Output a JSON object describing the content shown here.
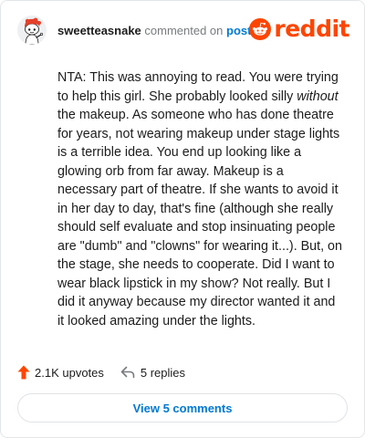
{
  "header": {
    "username": "sweetteasnake",
    "action_text": " commented on ",
    "post_link": "post",
    "brand_wordmark": "reddit",
    "brand_color": "#ff4500",
    "avatar_icon": "snoo-avatar-icon"
  },
  "comment": {
    "part1": "NTA: This was annoying to read. You were trying to help this girl. She probably looked silly ",
    "emphasis": "without",
    "part2": " the makeup. As someone who has done theatre for years, not wearing makeup under stage lights is a terrible idea. You end up looking like a glowing orb from far away. Makeup is a necessary part of theatre. If she wants to avoid it in her day to day, that's fine (although she really should self evaluate and stop insinuating people are \"dumb\" and \"clowns\" for wearing it...). But, on the stage, she needs to cooperate. Did I want to wear black lipstick in my show? Not really. But I did it anyway because my director wanted it and it looked amazing under the lights."
  },
  "footer": {
    "upvotes": "2.1K upvotes",
    "replies": "5 replies",
    "view_comments": "View 5 comments",
    "upvote_icon": "upvote-arrow-icon",
    "reply_icon": "reply-arrow-icon",
    "upvote_color": "#ff4500",
    "link_color": "#0079d3"
  }
}
